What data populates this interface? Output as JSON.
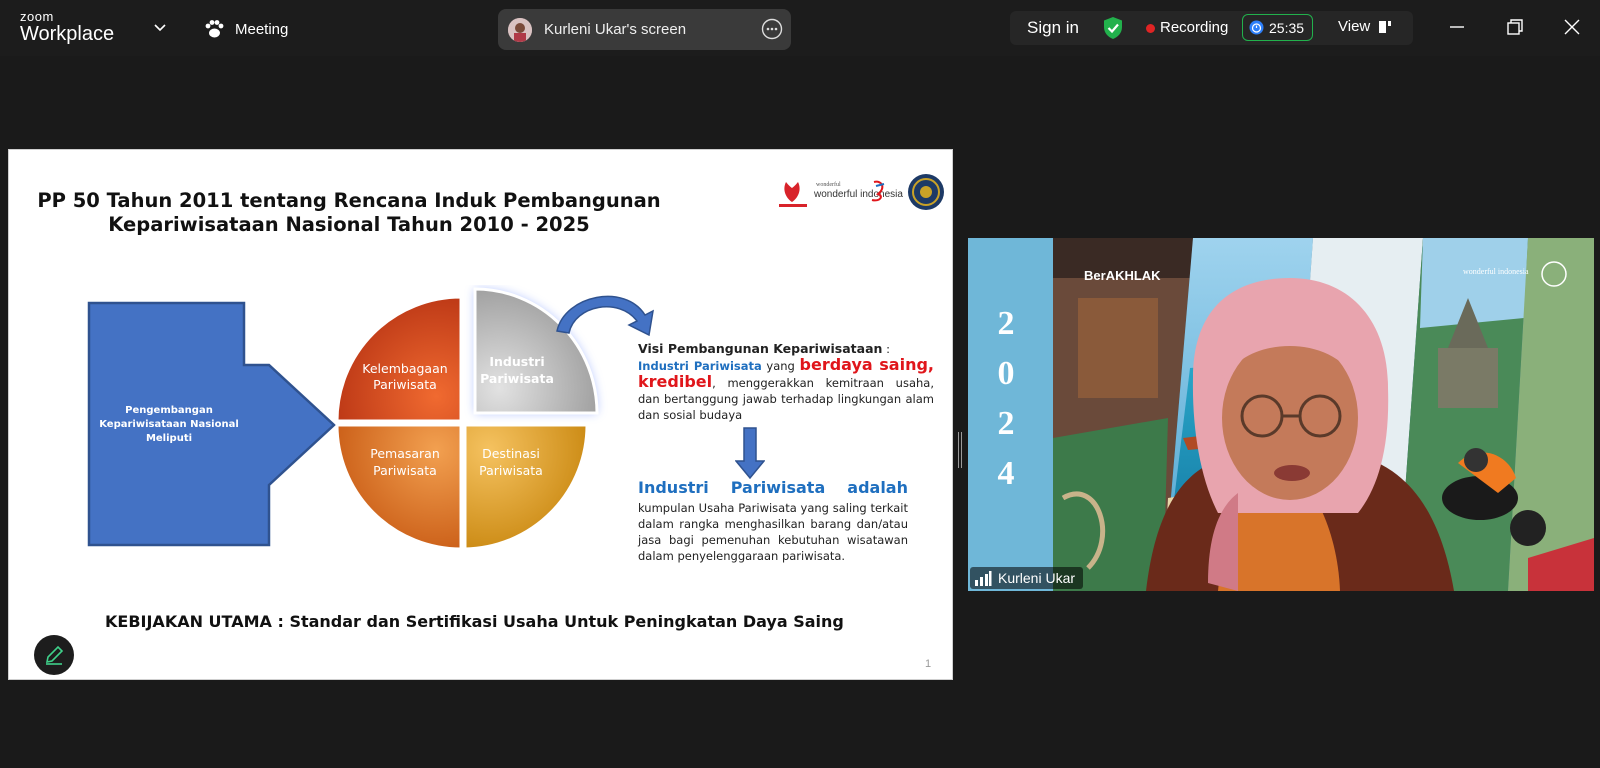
{
  "app": {
    "brand_top": "zoom",
    "brand_bottom": "Workplace"
  },
  "header": {
    "meeting_label": "Meeting",
    "share_label": "Kurleni Ukar's screen",
    "sign_in": "Sign in",
    "recording": "Recording",
    "timer": "25:35",
    "view": "View"
  },
  "slide": {
    "title_line1": "PP 50 Tahun 2011 tentang Rencana Induk Pembangunan",
    "title_line2": "Kepariwisataan Nasional Tahun 2010 - 2025",
    "logo_text": "wonderful indonesia",
    "arrow_label_1": "Pengembangan",
    "arrow_label_2": "Kepariwisataan Nasional",
    "arrow_label_3": "Meliputi",
    "quad_tl_1": "Kelembagaan",
    "quad_tl_2": "Pariwisata",
    "quad_tr_1": "Industri",
    "quad_tr_2": "Pariwisata",
    "quad_bl_1": "Pemasaran",
    "quad_bl_2": "Pariwisata",
    "quad_br_1": "Destinasi",
    "quad_br_2": "Pariwisata",
    "visi_heading": "Visi Pembangunan Kepariwisataan",
    "visi_colon": " :",
    "visi_blue": "Industri Pariwisata",
    "visi_yang": " yang ",
    "visi_red1": "berdaya saing,",
    "visi_red2": "kredibel",
    "visi_rest": ", menggerakkan kemitraan usaha, dan bertanggung jawab terhadap lingkungan alam dan sosial budaya",
    "indus_h1": "Industri",
    "indus_h2": "Pariwisata",
    "indus_h3": "adalah",
    "indus_body": "kumpulan Usaha Pariwisata yang saling terkait dalam rangka menghasilkan barang dan/atau jasa bagi pemenuhan kebutuhan wisatawan dalam penyelenggaraan pariwisata.",
    "kebijakan": "KEBIJAKAN UTAMA : Standar dan Sertifikasi Usaha Untuk Peningkatan Daya Saing",
    "page_number": "1"
  },
  "video": {
    "participant_name": "Kurleni Ukar",
    "bg_brand": "BerAKHLAK",
    "year_digits": [
      "2",
      "0",
      "2",
      "4"
    ],
    "bg_logo": "wonderful indonesia"
  },
  "colors": {
    "recording_red": "#e02424",
    "timer_green": "#22b14c",
    "shield_green": "#22b14c",
    "arrow_blue": "#4472c4",
    "quad_red": "#c8401a",
    "quad_gray": "#a8a8a8",
    "quad_orange": "#e07a20",
    "quad_gold": "#e0a020",
    "text_blue": "#1f6fbf",
    "text_red": "#e0161b"
  },
  "icons": [
    "chevron-down-icon",
    "paw-icon",
    "more-icon",
    "shield-check-icon",
    "timer-icon",
    "layout-icon",
    "minimize-icon",
    "restore-icon",
    "close-icon",
    "pencil-icon",
    "signal-icon"
  ]
}
